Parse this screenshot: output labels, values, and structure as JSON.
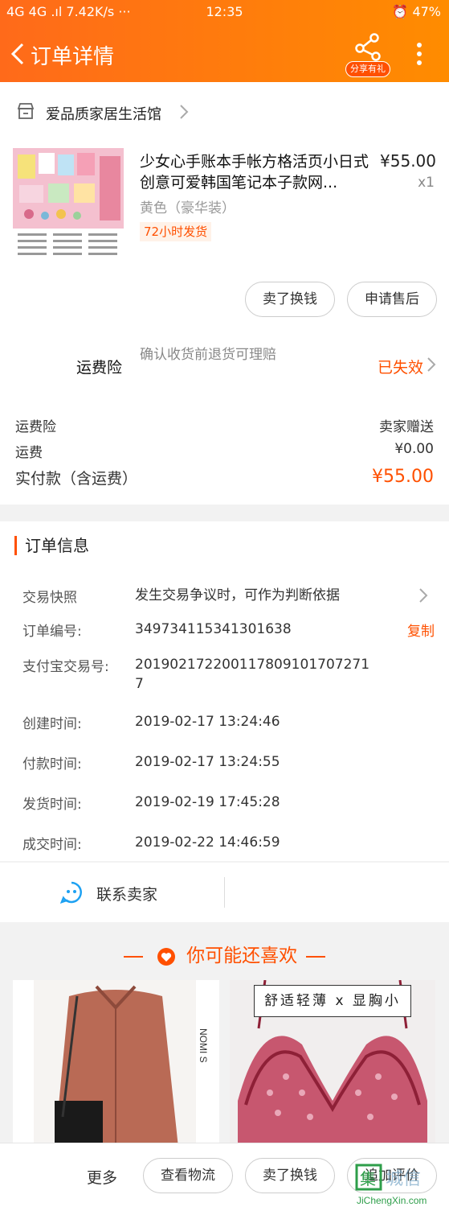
{
  "status_bar": {
    "left": "4G 4G .ıl 7.42K/s ···",
    "time": "12:35",
    "right": "47%"
  },
  "nav": {
    "title": "订单详情",
    "share_badge": "分享有礼"
  },
  "shop": {
    "name": "爱品质家居生活馆"
  },
  "product": {
    "title": "少女心手账本手帐方格活页小日式创意可爱韩国笔记本子款网...",
    "price": "¥55.00",
    "qty": "x1",
    "sku": "黄色（豪华装）",
    "tag": "72小时发货"
  },
  "product_actions": {
    "sell": "卖了换钱",
    "after_sale": "申请售后"
  },
  "insurance": {
    "label": "运费险",
    "desc": "确认收货前退货可理赔",
    "status": "已失效"
  },
  "fees": {
    "ins_label": "运费险",
    "ins_value": "卖家赠送",
    "shipping_label": "运费",
    "shipping_value": "¥0.00",
    "total_label": "实付款（含运费）",
    "total_value": "¥55.00"
  },
  "order_info": {
    "title": "订单信息",
    "snapshot_key": "交易快照",
    "snapshot_value": "发生交易争议时，可作为判断依据",
    "order_no_key": "订单编号:",
    "order_no": "349734115341301638",
    "copy": "复制",
    "alipay_key": "支付宝交易号:",
    "alipay_no": "2019021722001178091017072717",
    "created_key": "创建时间:",
    "created": "2019-02-17 13:24:46",
    "paid_key": "付款时间:",
    "paid": "2019-02-17 13:24:55",
    "shipped_key": "发货时间:",
    "shipped": "2019-02-19 17:45:28",
    "done_key": "成交时间:",
    "done": "2019-02-22 14:46:59"
  },
  "contact": {
    "label": "联系卖家"
  },
  "recommend": {
    "title": "你可能还喜欢",
    "item2_caption": "舒适轻薄 x 显胸小",
    "item1_side_text": "NOMI S"
  },
  "bottom_bar": {
    "more": "更多",
    "logistics": "查看物流",
    "sell": "卖了换钱",
    "review": "追加评价"
  },
  "watermark": {
    "site": "JiChengXin.com"
  },
  "colors": {
    "accent": "#ff5000",
    "header_gradient_start": "#ff6a1a",
    "header_gradient_end": "#ff8c00"
  }
}
